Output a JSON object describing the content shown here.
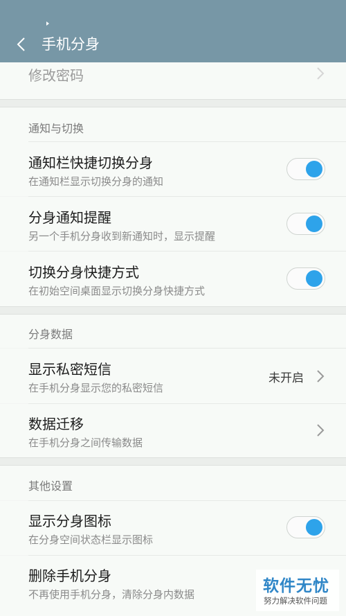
{
  "header": {
    "title": "手机分身"
  },
  "rows": {
    "change_password": {
      "title": "修改密码"
    },
    "notify_bar_switch": {
      "title": "通知栏快捷切换分身",
      "subtitle": "在通知栏显示切换分身的通知",
      "on": true
    },
    "clone_notification": {
      "title": "分身通知提醒",
      "subtitle": "另一个手机分身收到新通知时，显示提醒",
      "on": true
    },
    "switch_shortcut": {
      "title": "切换分身快捷方式",
      "subtitle": "在初始空间桌面显示切换分身快捷方式",
      "on": true
    },
    "private_sms": {
      "title": "显示私密短信",
      "subtitle": "在手机分身显示您的私密短信",
      "value": "未开启"
    },
    "data_migration": {
      "title": "数据迁移",
      "subtitle": "在手机分身之间传输数据"
    },
    "show_icon": {
      "title": "显示分身图标",
      "subtitle": "在分身空间状态栏显示图标",
      "on": true
    },
    "delete_clone": {
      "title": "删除手机分身",
      "subtitle": "不再使用手机分身，清除分身内数据"
    }
  },
  "sections": {
    "notify": "通知与切换",
    "data": "分身数据",
    "other": "其他设置"
  },
  "watermark": {
    "main": "软件无忧",
    "sub": "努力解决软件问题"
  },
  "colors": {
    "header_bg": "#7797a6",
    "toggle_on": "#2ea3ea",
    "watermark": "#2f86c7"
  },
  "icons": {
    "back": "chevron-left-icon",
    "more": "chevron-right-icon"
  }
}
